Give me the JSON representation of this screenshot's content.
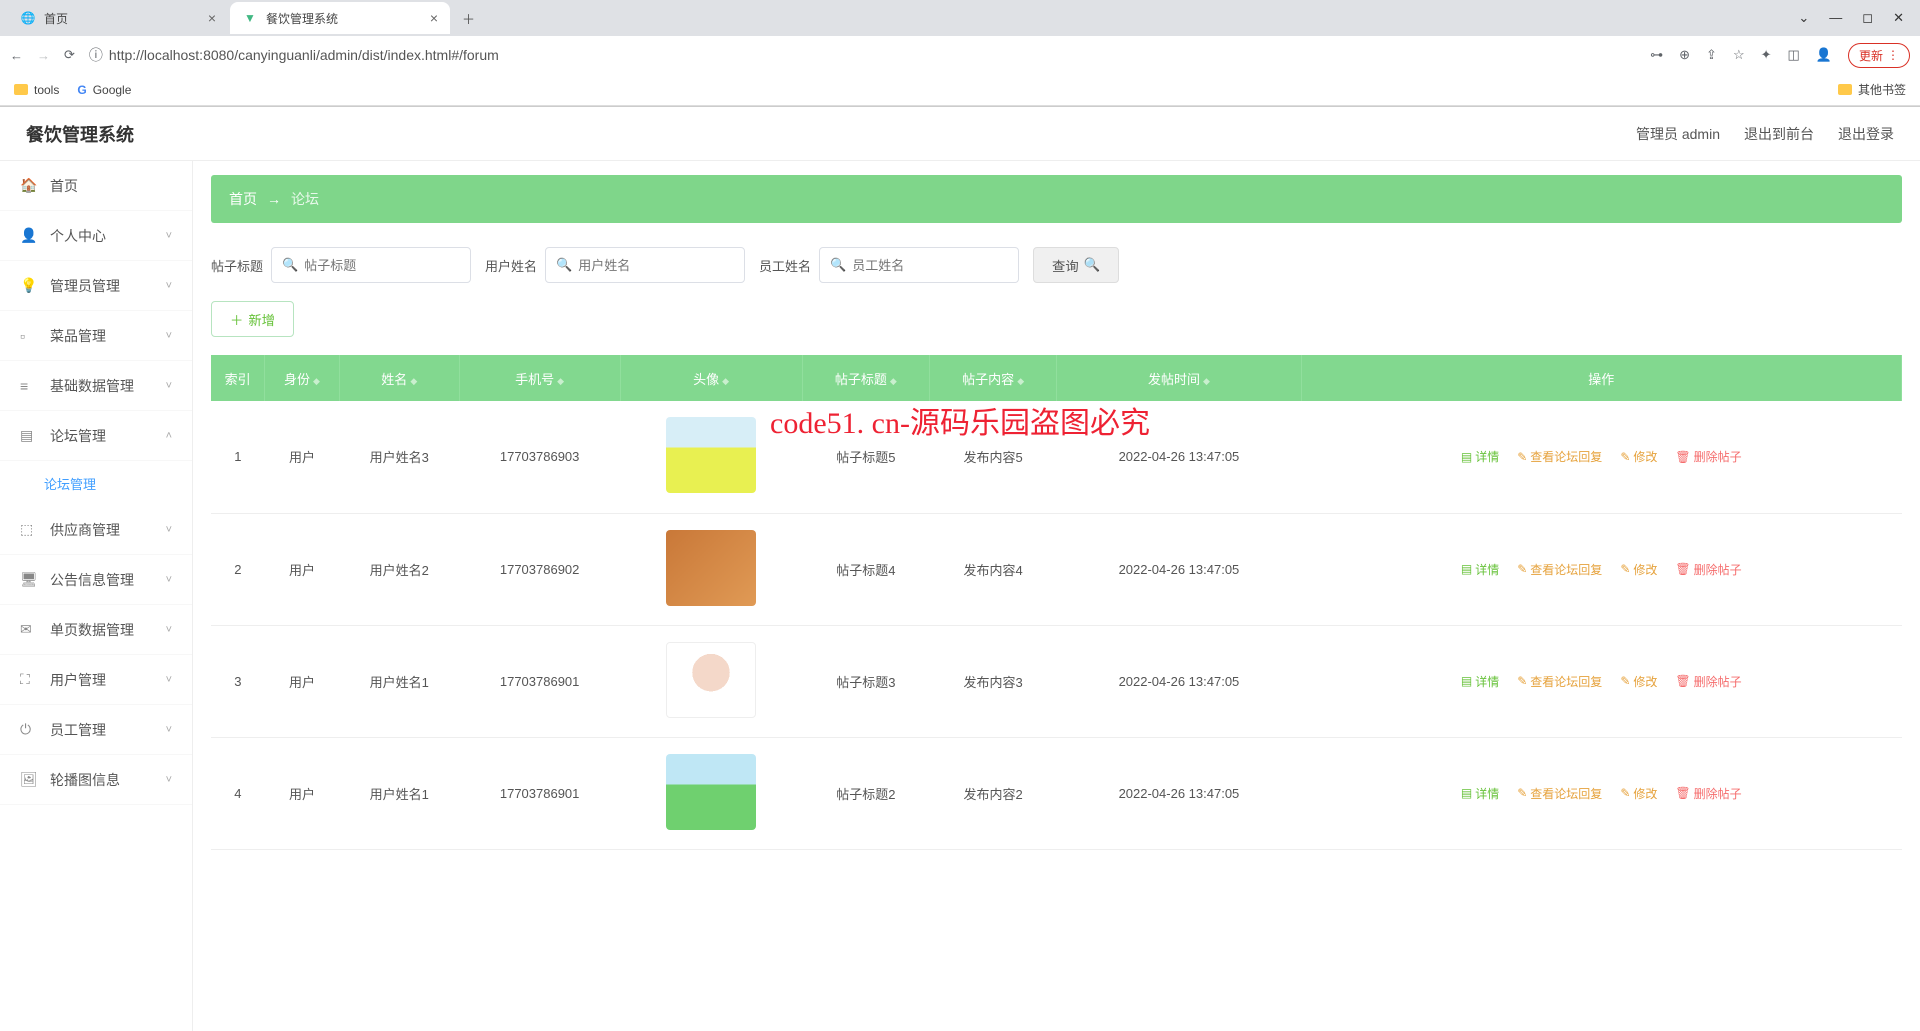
{
  "browser": {
    "tabs": [
      {
        "title": "首页",
        "active": false
      },
      {
        "title": "餐饮管理系统",
        "active": true
      }
    ],
    "url": "http://localhost:8080/canyinguanli/admin/dist/index.html#/forum",
    "update_label": "更新",
    "bookmarks": {
      "tools": "tools",
      "google": "Google",
      "other": "其他书签"
    }
  },
  "app": {
    "title": "餐饮管理系统",
    "user_label": "管理员 admin",
    "to_front": "退出到前台",
    "logout": "退出登录"
  },
  "sidebar": {
    "items": [
      {
        "label": "首页",
        "icon": "home",
        "expandable": false
      },
      {
        "label": "个人中心",
        "icon": "user",
        "expandable": true
      },
      {
        "label": "管理员管理",
        "icon": "bulb",
        "expandable": true
      },
      {
        "label": "菜品管理",
        "icon": "bars",
        "expandable": true
      },
      {
        "label": "基础数据管理",
        "icon": "list",
        "expandable": true
      },
      {
        "label": "论坛管理",
        "icon": "layer",
        "expandable": true,
        "expanded": true,
        "children": [
          {
            "label": "论坛管理"
          }
        ]
      },
      {
        "label": "供应商管理",
        "icon": "box",
        "expandable": true
      },
      {
        "label": "公告信息管理",
        "icon": "monitor",
        "expandable": true
      },
      {
        "label": "单页数据管理",
        "icon": "mail",
        "expandable": true
      },
      {
        "label": "用户管理",
        "icon": "expand",
        "expandable": true
      },
      {
        "label": "员工管理",
        "icon": "power",
        "expandable": true
      },
      {
        "label": "轮播图信息",
        "icon": "image",
        "expandable": true
      }
    ]
  },
  "breadcrumb": {
    "home": "首页",
    "sep": "→",
    "current": "论坛"
  },
  "search": {
    "post_title_label": "帖子标题",
    "post_title_ph": "帖子标题",
    "user_name_label": "用户姓名",
    "user_name_ph": "用户姓名",
    "staff_name_label": "员工姓名",
    "staff_name_ph": "员工姓名",
    "query_label": "查询",
    "add_label": "新增"
  },
  "table": {
    "headers": {
      "index": "索引",
      "role": "身份",
      "name": "姓名",
      "phone": "手机号",
      "avatar": "头像",
      "title": "帖子标题",
      "content": "帖子内容",
      "time": "发帖时间",
      "ops": "操作"
    },
    "ops": {
      "detail": "详情",
      "reply": "查看论坛回复",
      "edit": "修改",
      "del": "删除帖子"
    },
    "rows": [
      {
        "index": "1",
        "role": "用户",
        "name": "用户姓名3",
        "phone": "17703786903",
        "avatar": "av1",
        "title": "帖子标题5",
        "content": "发布内容5",
        "time": "2022-04-26 13:47:05"
      },
      {
        "index": "2",
        "role": "用户",
        "name": "用户姓名2",
        "phone": "17703786902",
        "avatar": "av2",
        "title": "帖子标题4",
        "content": "发布内容4",
        "time": "2022-04-26 13:47:05"
      },
      {
        "index": "3",
        "role": "用户",
        "name": "用户姓名1",
        "phone": "17703786901",
        "avatar": "av3",
        "title": "帖子标题3",
        "content": "发布内容3",
        "time": "2022-04-26 13:47:05"
      },
      {
        "index": "4",
        "role": "用户",
        "name": "用户姓名1",
        "phone": "17703786901",
        "avatar": "av4",
        "title": "帖子标题2",
        "content": "发布内容2",
        "time": "2022-04-26 13:47:05"
      }
    ]
  },
  "watermark": "code51. cn-源码乐园盗图必究"
}
